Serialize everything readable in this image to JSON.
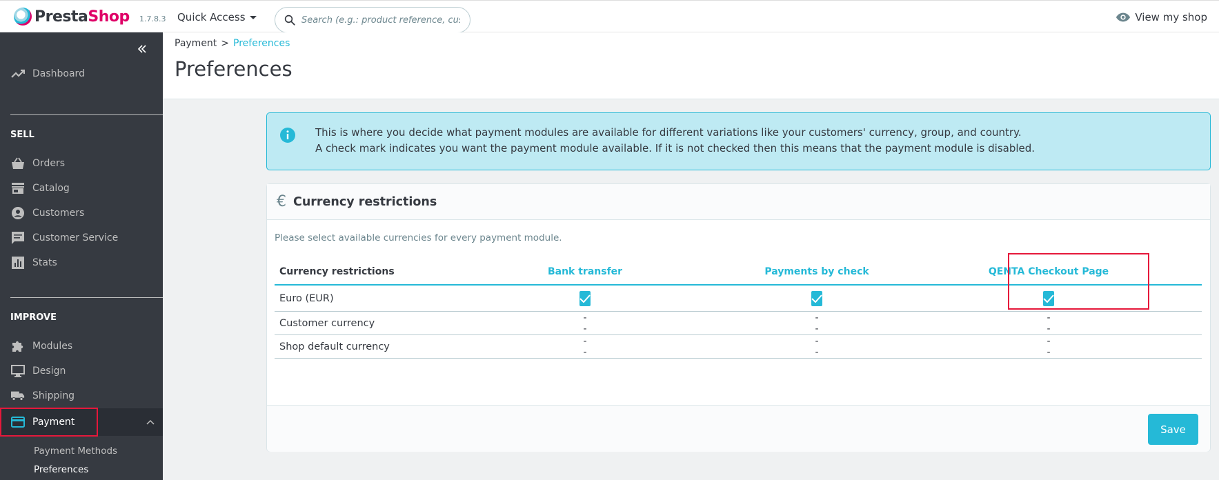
{
  "header": {
    "logo_text_a": "Presta",
    "logo_text_b": "Shop",
    "version": "1.7.8.3",
    "quick_access": "Quick Access",
    "search_placeholder": "Search (e.g.: product reference, custon",
    "view_shop": "View my shop"
  },
  "sidebar": {
    "dashboard": "Dashboard",
    "sell_title": "SELL",
    "orders": "Orders",
    "catalog": "Catalog",
    "customers": "Customers",
    "customer_service": "Customer Service",
    "stats": "Stats",
    "improve_title": "IMPROVE",
    "modules": "Modules",
    "design": "Design",
    "shipping": "Shipping",
    "payment": "Payment",
    "sub_payment_methods": "Payment Methods",
    "sub_preferences": "Preferences"
  },
  "breadcrumb": {
    "parent": "Payment",
    "separator": ">",
    "current": "Preferences"
  },
  "page_title": "Preferences",
  "alert": {
    "line1": "This is where you decide what payment modules are available for different variations like your customers' currency, group, and country.",
    "line2": "A check mark indicates you want the payment module available. If it is not checked then this means that the payment module is disabled."
  },
  "panel": {
    "title": "Currency restrictions",
    "description": "Please select available currencies for every payment module.",
    "columns": [
      "Currency restrictions",
      "Bank transfer",
      "Payments by check",
      "QENTA Checkout Page"
    ],
    "rows": [
      {
        "label": "Euro (EUR)",
        "values": [
          "checked",
          "checked",
          "checked"
        ]
      },
      {
        "label": "Customer currency",
        "values": [
          "--",
          "--",
          "--"
        ]
      },
      {
        "label": "Shop default currency",
        "values": [
          "--",
          "--",
          "--"
        ]
      }
    ],
    "save_label": "Save"
  },
  "colors": {
    "accent": "#25b9d7",
    "sidebar_bg": "#363a41",
    "highlight": "#e6183b",
    "brand_pink": "#df0067"
  }
}
